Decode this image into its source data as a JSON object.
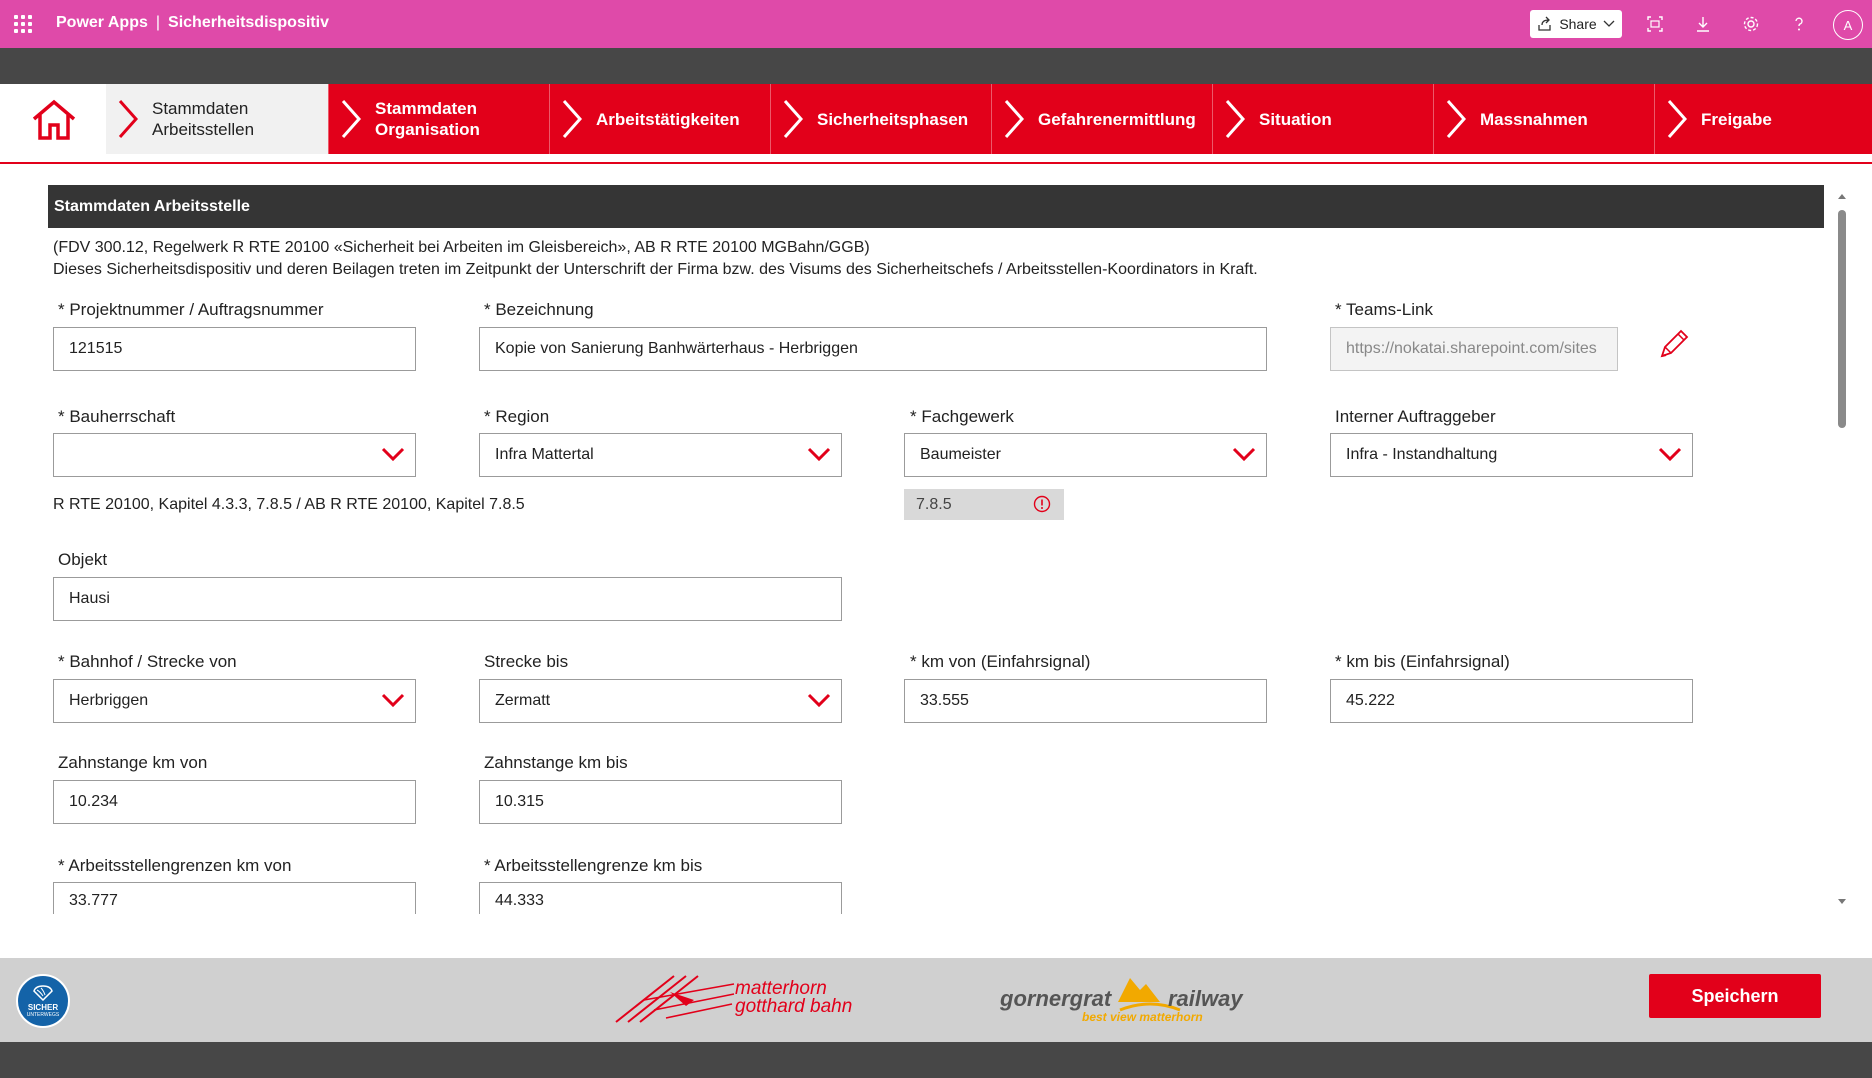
{
  "appbar": {
    "app_name": "Power Apps",
    "separator": "|",
    "app_title": "Sicherheitsdispositiv",
    "share_label": "Share",
    "avatar_initial": "A",
    "bg_color": "#df4aa9"
  },
  "nav": {
    "accent_color": "#e2001a",
    "tabs": [
      {
        "line1": "Stammdaten",
        "line2": "Arbeitsstellen",
        "active": true
      },
      {
        "line1": "Stammdaten",
        "line2": "Organisation",
        "active": false
      },
      {
        "line1": "Arbeitstätigkeiten",
        "line2": "",
        "active": false
      },
      {
        "line1": "Sicherheitsphasen",
        "line2": "",
        "active": false
      },
      {
        "line1": "Gefahrenermittlung",
        "line2": "",
        "active": false
      },
      {
        "line1": "Situation",
        "line2": "",
        "active": false
      },
      {
        "line1": "Massnahmen",
        "line2": "",
        "active": false
      },
      {
        "line1": "Freigabe",
        "line2": "",
        "active": false
      }
    ]
  },
  "form": {
    "section_title": "Stammdaten Arbeitsstelle",
    "desc_line1": "(FDV 300.12, Regelwerk R RTE 20100 «Sicherheit bei Arbeiten im Gleisbereich», AB R RTE 20100 MGBahn/GGB)",
    "desc_line2": "Dieses Sicherheitsdispositiv und deren Beilagen treten im Zeitpunkt der Unterschrift der Firma bzw. des Visums des Sicherheitschefs / Arbeitsstellen-Koordinators in Kraft.",
    "projektnummer": {
      "label": "* Projektnummer / Auftragsnummer",
      "value": "121515"
    },
    "bezeichnung": {
      "label": "* Bezeichnung",
      "value": "Kopie von Sanierung Banhwärterhaus - Herbriggen"
    },
    "teams_link": {
      "label": "* Teams-Link",
      "value": "https://nokatai.sharepoint.com/sites"
    },
    "bauherrschaft": {
      "label": "* Bauherrschaft",
      "value": ""
    },
    "region": {
      "label": "* Region",
      "value": "Infra Mattertal"
    },
    "fachgewerk": {
      "label": "* Fachgewerk",
      "value": "Baumeister"
    },
    "interner_auftraggeber": {
      "label": "Interner Auftraggeber",
      "value": "Infra - Instandhaltung"
    },
    "chapter_note": "R RTE 20100, Kapitel 4.3.3, 7.8.5 / AB R RTE 20100, Kapitel 7.8.5",
    "chapter_value": "7.8.5",
    "objekt": {
      "label": "Objekt",
      "value": "Hausi"
    },
    "bahnhof_von": {
      "label": "* Bahnhof / Strecke von",
      "value": "Herbriggen"
    },
    "strecke_bis": {
      "label": "Strecke bis",
      "value": "Zermatt"
    },
    "km_von": {
      "label": "* km von (Einfahrsignal)",
      "value": "33.555"
    },
    "km_bis": {
      "label": "* km bis (Einfahrsignal)",
      "value": "45.222"
    },
    "zahnstange_von": {
      "label": "Zahnstange km von",
      "value": "10.234"
    },
    "zahnstange_bis": {
      "label": "Zahnstange km bis",
      "value": "10.315"
    },
    "grenzen_von": {
      "label": "* Arbeitsstellengrenzen km von",
      "value": "33.777"
    },
    "grenze_bis": {
      "label": "* Arbeitsstellengrenze km bis",
      "value": "44.333"
    }
  },
  "footer": {
    "save_label": "Speichern",
    "sicher_line1": "SICHER",
    "sicher_line2": "UNTERWEGS",
    "mgb_line1": "matterhorn",
    "mgb_line2": "gotthard bahn",
    "ggb_word1": "gornergrat",
    "ggb_word2": "railway",
    "ggb_tagline": "best view matterhorn"
  }
}
